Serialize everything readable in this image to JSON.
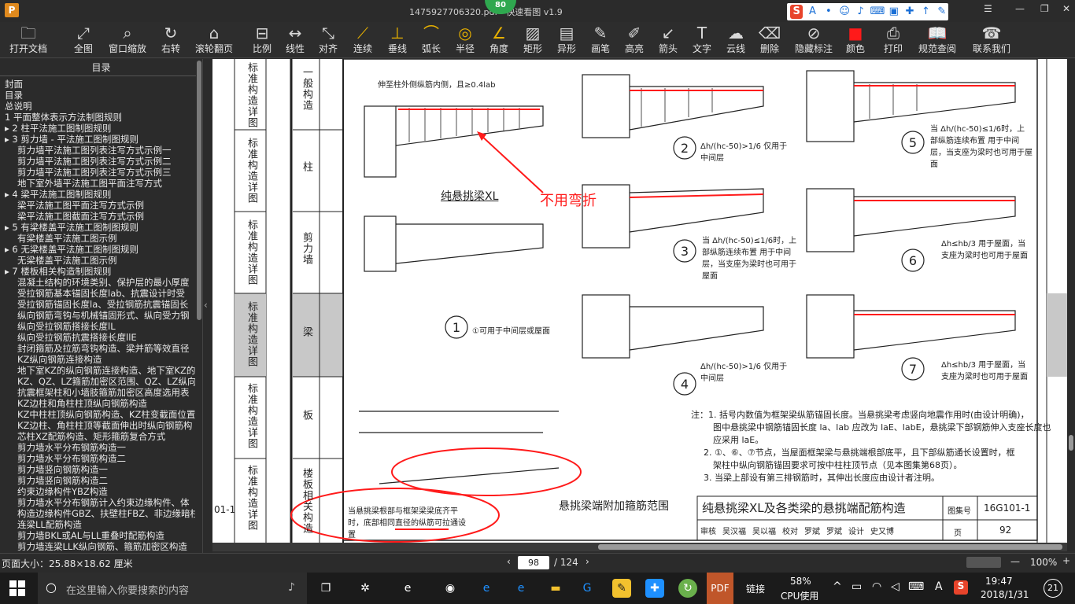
{
  "window": {
    "title": "1475927706320.pdf - 快速看图 v1.9",
    "badge": "80"
  },
  "toolbar": {
    "items": [
      {
        "label": "打开文档",
        "icon": "folder-icon"
      },
      {
        "label": "全图",
        "icon": "fit-icon"
      },
      {
        "label": "窗口缩放",
        "icon": "zoom-icon"
      },
      {
        "label": "右转",
        "icon": "rotate-icon"
      },
      {
        "label": "滚轮翻页",
        "icon": "mouse-icon"
      },
      {
        "label": "比例",
        "icon": "scale-icon"
      },
      {
        "label": "线性",
        "icon": "linear-icon"
      },
      {
        "label": "对齐",
        "icon": "align-icon"
      },
      {
        "label": "连续",
        "icon": "continuous-icon"
      },
      {
        "label": "垂线",
        "icon": "perpendicular-icon"
      },
      {
        "label": "弧长",
        "icon": "arc-icon"
      },
      {
        "label": "半径",
        "icon": "radius-icon"
      },
      {
        "label": "角度",
        "icon": "angle-icon"
      },
      {
        "label": "矩形",
        "icon": "rectangle-icon"
      },
      {
        "label": "异形",
        "icon": "polygon-icon"
      },
      {
        "label": "画笔",
        "icon": "pen-icon"
      },
      {
        "label": "高亮",
        "icon": "highlight-icon"
      },
      {
        "label": "箭头",
        "icon": "arrow-icon"
      },
      {
        "label": "文字",
        "icon": "text-icon"
      },
      {
        "label": "云线",
        "icon": "cloud-icon"
      },
      {
        "label": "删除",
        "icon": "eraser-icon"
      },
      {
        "label": "隐藏标注",
        "icon": "hide-icon"
      },
      {
        "label": "颜色",
        "icon": "color-icon"
      },
      {
        "label": "打印",
        "icon": "print-icon"
      },
      {
        "label": "规范查阅",
        "icon": "book-icon"
      },
      {
        "label": "联系我们",
        "icon": "contact-icon"
      }
    ],
    "colors": {
      "red": "#ff1a1a",
      "measure": "#e8b100"
    }
  },
  "sidebar": {
    "header": "目录",
    "items": [
      "封面",
      "目录",
      "总说明",
      "1 平面整体表示方法制图规则",
      "▸ 2 柱平法施工图制图规则",
      "▸ 3 剪力墙 - 平法施工图制图规则",
      "剪力墙平法施工图列表注写方式示例一",
      "剪力墙平法施工图列表注写方式示例二",
      "剪力墙平法施工图列表注写方式示例三",
      "地下室外墙平法施工图平面注写方式",
      "▸ 4 梁平法施工图制图规则",
      "梁平法施工图平面注写方式示例",
      "梁平法施工图截面注写方式示例",
      "▸ 5 有梁楼盖平法施工图制图规则",
      "有梁楼盖平法施工图示例",
      "▸ 6 无梁楼盖平法施工图制图规则",
      "无梁楼盖平法施工图示例",
      "▸ 7 楼板相关构造制图规则",
      "混凝土结构的环境类别、保护层的最小厚度",
      "受拉钢筋基本锚固长度lab、抗震设计时受",
      "受拉钢筋锚固长度la、受拉钢筋抗震锚固长",
      "纵向钢筋弯钩与机械锚固形式、纵向受力钢",
      "纵向受拉钢筋搭接长度lL",
      "纵向受拉钢筋抗震搭接长度llE",
      "封闭箍筋及拉筋弯钩构造、梁并筋等效直径",
      "KZ纵向钢筋连接构造",
      "地下室KZ的纵向钢筋连接构造、地下室KZ的",
      "KZ、QZ、LZ箍筋加密区范围、QZ、LZ纵向钢",
      "抗震框架柱和小墙肢箍筋加密区高度选用表",
      "KZ边柱和角柱柱顶纵向钢筋构造",
      "KZ中柱柱顶纵向钢筋构造、KZ柱变截面位置",
      "KZ边柱、角柱柱顶等截面伸出时纵向钢筋构",
      "芯柱XZ配筋构造、矩形箍筋复合方式",
      "剪力墙水平分布钢筋构造一",
      "剪力墙水平分布钢筋构造二",
      "剪力墙竖向钢筋构造一",
      "剪力墙竖向钢筋构造二",
      "约束边缘构件YBZ构造",
      "剪力墙水平分布钢筋计入约束边缘构件、体",
      "构造边缘构件GBZ、扶壁柱FBZ、非边缘暗柱",
      "连梁LL配筋构造",
      "剪力墙BKL或AL与LL重叠时配筋构造",
      "剪力墙连梁LLK纵向钢筋、箍筋加密区构造"
    ]
  },
  "document": {
    "left_tabs": [
      "标准构造详图",
      "标准构造详图",
      "标准构造详图",
      "标准构造详图",
      "标准构造详图",
      "标准构造详图"
    ],
    "left_sections": [
      "一般构造",
      "柱",
      "剪力墙",
      "梁",
      "板",
      "楼板相关构造"
    ],
    "labels": {
      "title_main": "纯悬挑梁XL及各类梁的悬挑端配筋构造",
      "atlas_label": "图集号",
      "atlas_no": "16G101-1",
      "page_label": "页",
      "page_no": "92",
      "xl_label": "纯悬挑梁XL",
      "stirrup_label": "悬挑梁端附加箍筋范围",
      "red_note": "不用弯折",
      "note1": "注：1. 括号内数值为框架梁纵筋锚固长度。当悬挑梁考虑竖向地震作用时(由设计明确)，",
      "note1b": "图中悬挑梁中钢筋锚固长度 la、lab 应改为 laE、labE，悬挑梁下部钢筋伸入支座长度也",
      "note1c": "应采用 laE。",
      "note2": "2. ①、⑥、⑦节点，当屋面框架梁与悬挑端根部底平，且下部纵筋通长设置时，框",
      "note2b": "架柱中纵向钢筋锚固要求可按中柱柱顶节点（见本图集第68页）。",
      "note3": "3. 当梁上部设有第三排钢筋时，其伸出长度应由设计者注明。",
      "bottom_note": "当悬挑梁根部与框架梁梁底齐平时，底部相同直径的纵筋可拉通设置",
      "sig_row": [
        "审核",
        "吴汉福",
        "吴以福",
        "校对",
        "罗斌",
        "罗斌",
        "设计",
        "史又博"
      ],
      "upper_note": "伸至柱外侧纵筋内侧，且≥0.4lab",
      "left_pdf": "01-1",
      "sec1": "①可用于中间层或屋面",
      "sec2": "Δh/(hc-50)>1/6 仅用于中间层",
      "sec3": "当 Δh/(hc-50)≤1/6时，上部纵筋连续布置 用于中间层，当支座为梁时也可用于屋面",
      "sec4": "Δh/(hc-50)>1/6 仅用于中间层",
      "sec5": "当 Δh/(hc-50)≤1/6时，上部纵筋连续布置 用于中间层，当支座为梁时也可用于屋面",
      "sec6": "Δh≤hb/3 用于屋面，当支座为梁时也可用于屋面",
      "sec7": "Δh≤hb/3 用于屋面，当支座为梁时也可用于屋面"
    }
  },
  "status": {
    "page_size": "页面大小：25.88×18.62 厘米",
    "page_current": "98",
    "page_total": "/ 124",
    "zoom": "100%"
  },
  "taskbar": {
    "search_placeholder": "在这里输入你要搜索的内容",
    "link_label": "链接",
    "cpu_percent": "58%",
    "cpu_label": "CPU使用",
    "time": "19:47",
    "date": "2018/1/31",
    "notif": "21",
    "ime": "A"
  }
}
